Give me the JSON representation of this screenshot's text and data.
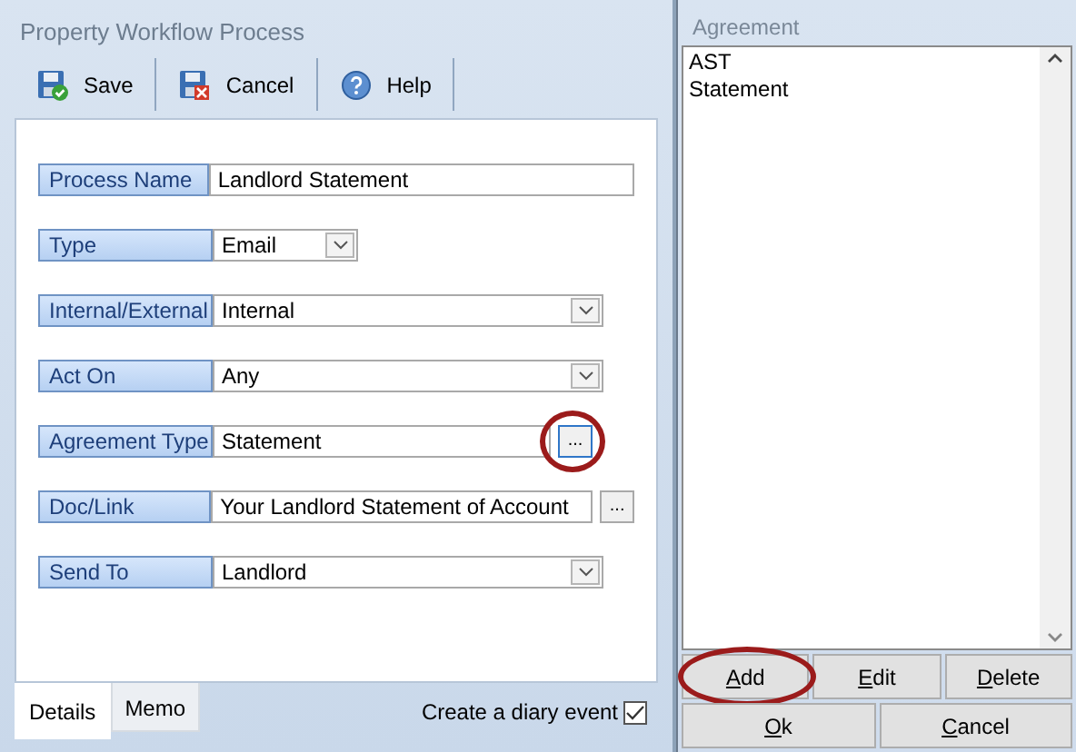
{
  "window": {
    "title": "Property Workflow Process"
  },
  "toolbar": [
    {
      "label": "Save",
      "kind": "save"
    },
    {
      "label": "Cancel",
      "kind": "cancel"
    },
    {
      "label": "Help",
      "kind": "help"
    }
  ],
  "fields": [
    {
      "label": "Process Name",
      "kind": "text",
      "value": "Landlord Statement"
    },
    {
      "label": "Type",
      "kind": "select",
      "value": "Email"
    },
    {
      "label": "Internal/External",
      "kind": "select",
      "value": "Internal"
    },
    {
      "label": "Act On",
      "kind": "select",
      "value": "Any"
    },
    {
      "label": "Agreement Type",
      "kind": "picker",
      "value": "Statement",
      "button": "...",
      "highlighted": true
    },
    {
      "label": "Doc/Link",
      "kind": "picker",
      "value": "Your Landlord Statement of Account",
      "button": "...",
      "highlighted": false
    },
    {
      "label": "Send To",
      "kind": "select",
      "value": "Landlord"
    }
  ],
  "tabs": [
    {
      "label": "Details",
      "selected": true
    },
    {
      "label": "Memo",
      "selected": false
    }
  ],
  "diary_event": {
    "label": "Create a diary event",
    "checked": true
  },
  "agreement_panel": {
    "title": "Agreement",
    "items": [
      {
        "label": "AST"
      },
      {
        "label": "Statement"
      }
    ],
    "buttons": [
      {
        "label": "Add",
        "mnemonic": true,
        "highlighted": true
      },
      {
        "label": "Edit",
        "mnemonic": true,
        "highlighted": false
      },
      {
        "label": "Delete",
        "mnemonic": true,
        "highlighted": false
      }
    ],
    "footer_buttons": [
      {
        "label": "Ok",
        "mnemonic": true
      },
      {
        "label": "Cancel",
        "mnemonic": true
      }
    ]
  }
}
